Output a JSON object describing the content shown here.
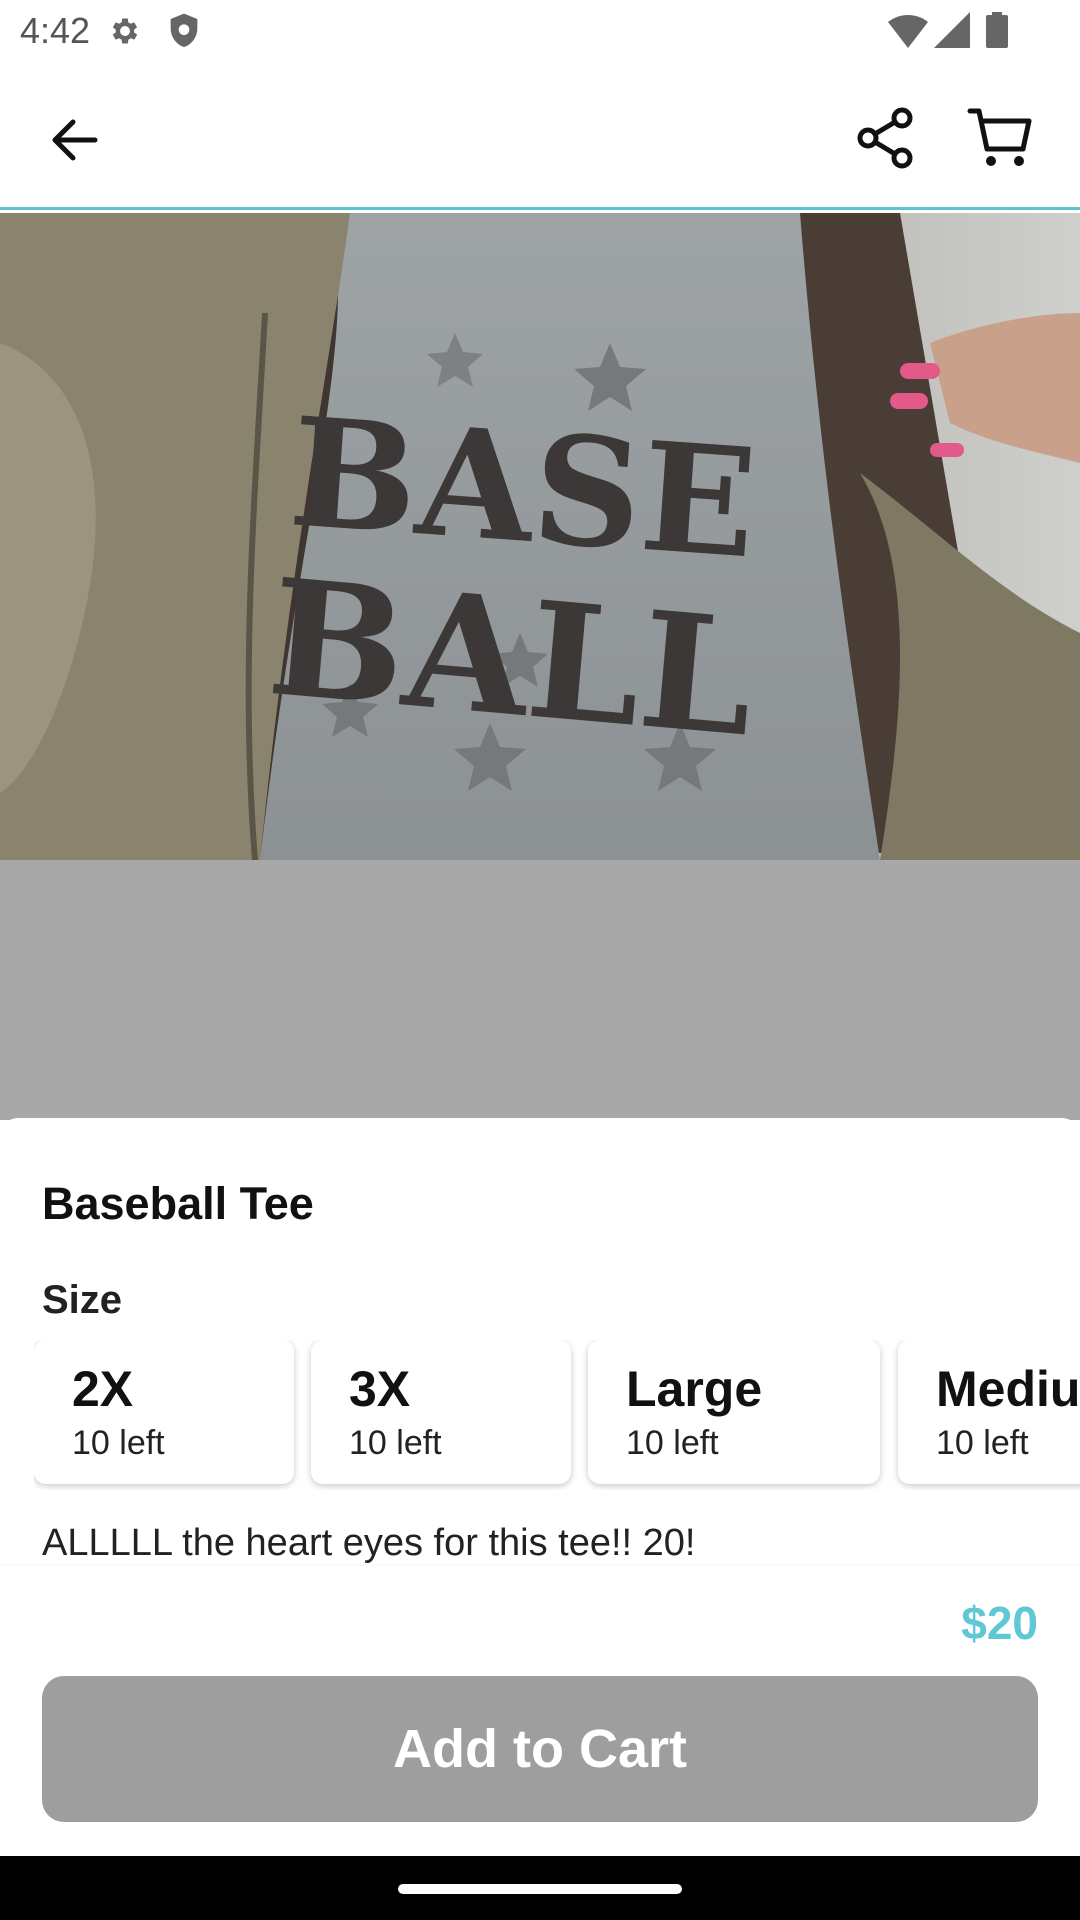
{
  "status_bar": {
    "time": "4:42",
    "icons": [
      "gear-icon",
      "shield-icon",
      "wifi-icon",
      "signal-icon",
      "battery-icon"
    ]
  },
  "app_bar": {
    "icons": [
      "back-arrow-icon",
      "share-icon",
      "cart-icon"
    ],
    "accent_color": "#5fc3cf"
  },
  "product": {
    "image_text_lines": [
      "BASE",
      "BALL"
    ],
    "title": "Baseball Tee",
    "size_heading": "Size",
    "sizes": [
      {
        "name": "2X",
        "stock": "10 left"
      },
      {
        "name": "3X",
        "stock": "10 left"
      },
      {
        "name": "Large",
        "stock": "10 left"
      },
      {
        "name": "Medium",
        "stock": "10 left"
      }
    ],
    "description": "ALLLLL the heart eyes for this tee!! 20!",
    "price": "$20",
    "price_color": "#5fc8d4"
  },
  "actions": {
    "add_to_cart_label": "Add to Cart",
    "button_color": "#9e9e9e"
  }
}
